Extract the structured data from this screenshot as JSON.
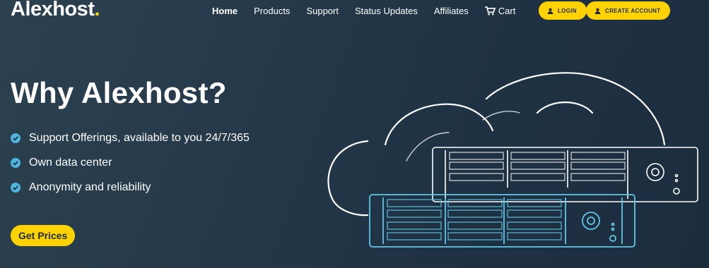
{
  "header": {
    "logo_text": "Alexhost",
    "logo_dot": ".",
    "nav": [
      {
        "label": "Home",
        "active": true
      },
      {
        "label": "Products",
        "active": false
      },
      {
        "label": "Support",
        "active": false
      },
      {
        "label": "Status Updates",
        "active": false
      },
      {
        "label": "Affiliates",
        "active": false
      }
    ],
    "cart_label": "Cart",
    "login_label": "LOGIN",
    "create_account_label": "CREATE ACCOUNT"
  },
  "hero": {
    "title": "Why Alexhost?",
    "features": [
      "Support Offerings, available to you 24/7/365",
      "Own data center",
      "Anonymity and reliability"
    ],
    "cta_label": "Get Prices"
  },
  "colors": {
    "accent": "#ffd200",
    "check": "#4fb6e0",
    "server_outline": "#5fc8e6",
    "background": "#233647"
  },
  "icons": [
    "cart-icon",
    "user-icon",
    "check-circle-icon",
    "cloud-server-illustration"
  ]
}
